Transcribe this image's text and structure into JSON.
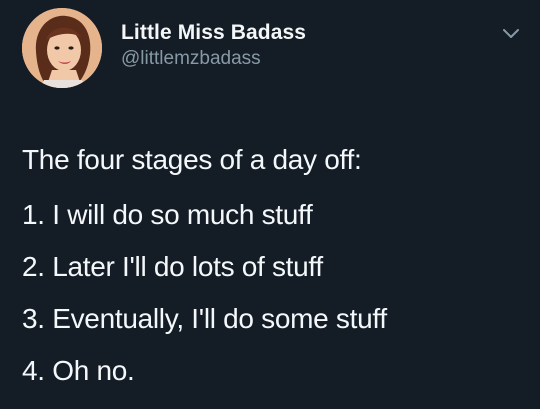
{
  "author": {
    "display_name": "Little Miss Badass",
    "handle": "@littlemzbadass",
    "avatar_icon": "profile-photo"
  },
  "menu": {
    "icon": "chevron-down-icon"
  },
  "tweet": {
    "lines": [
      "The four stages of a day off:",
      "1. I will do so much stuff",
      "2. Later I'll do lots of stuff",
      "3. Eventually, I'll do some stuff",
      "4. Oh no."
    ]
  },
  "colors": {
    "background": "#141d26",
    "text": "#f5f8fa",
    "muted": "#8899a6"
  }
}
